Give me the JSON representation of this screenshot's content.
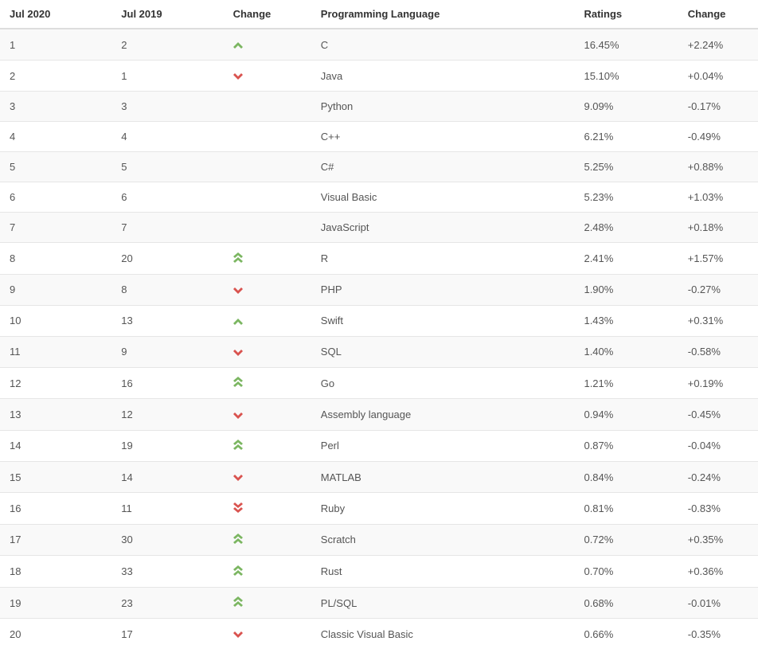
{
  "headers": {
    "jul2020": "Jul 2020",
    "jul2019": "Jul 2019",
    "change": "Change",
    "language": "Programming Language",
    "ratings": "Ratings",
    "delta": "Change"
  },
  "icons": {
    "up": "chevron-up-icon",
    "down": "chevron-down-icon",
    "uu": "double-chevron-up-icon",
    "dd": "double-chevron-down-icon",
    "none": ""
  },
  "rows": [
    {
      "jul2020": "1",
      "jul2019": "2",
      "trend": "up",
      "language": "C",
      "ratings": "16.45%",
      "delta": "+2.24%"
    },
    {
      "jul2020": "2",
      "jul2019": "1",
      "trend": "down",
      "language": "Java",
      "ratings": "15.10%",
      "delta": "+0.04%"
    },
    {
      "jul2020": "3",
      "jul2019": "3",
      "trend": "none",
      "language": "Python",
      "ratings": "9.09%",
      "delta": "-0.17%"
    },
    {
      "jul2020": "4",
      "jul2019": "4",
      "trend": "none",
      "language": "C++",
      "ratings": "6.21%",
      "delta": "-0.49%"
    },
    {
      "jul2020": "5",
      "jul2019": "5",
      "trend": "none",
      "language": "C#",
      "ratings": "5.25%",
      "delta": "+0.88%"
    },
    {
      "jul2020": "6",
      "jul2019": "6",
      "trend": "none",
      "language": "Visual Basic",
      "ratings": "5.23%",
      "delta": "+1.03%"
    },
    {
      "jul2020": "7",
      "jul2019": "7",
      "trend": "none",
      "language": "JavaScript",
      "ratings": "2.48%",
      "delta": "+0.18%"
    },
    {
      "jul2020": "8",
      "jul2019": "20",
      "trend": "uu",
      "language": "R",
      "ratings": "2.41%",
      "delta": "+1.57%"
    },
    {
      "jul2020": "9",
      "jul2019": "8",
      "trend": "down",
      "language": "PHP",
      "ratings": "1.90%",
      "delta": "-0.27%"
    },
    {
      "jul2020": "10",
      "jul2019": "13",
      "trend": "up",
      "language": "Swift",
      "ratings": "1.43%",
      "delta": "+0.31%"
    },
    {
      "jul2020": "11",
      "jul2019": "9",
      "trend": "down",
      "language": "SQL",
      "ratings": "1.40%",
      "delta": "-0.58%"
    },
    {
      "jul2020": "12",
      "jul2019": "16",
      "trend": "uu",
      "language": "Go",
      "ratings": "1.21%",
      "delta": "+0.19%"
    },
    {
      "jul2020": "13",
      "jul2019": "12",
      "trend": "down",
      "language": "Assembly language",
      "ratings": "0.94%",
      "delta": "-0.45%"
    },
    {
      "jul2020": "14",
      "jul2019": "19",
      "trend": "uu",
      "language": "Perl",
      "ratings": "0.87%",
      "delta": "-0.04%"
    },
    {
      "jul2020": "15",
      "jul2019": "14",
      "trend": "down",
      "language": "MATLAB",
      "ratings": "0.84%",
      "delta": "-0.24%"
    },
    {
      "jul2020": "16",
      "jul2019": "11",
      "trend": "dd",
      "language": "Ruby",
      "ratings": "0.81%",
      "delta": "-0.83%"
    },
    {
      "jul2020": "17",
      "jul2019": "30",
      "trend": "uu",
      "language": "Scratch",
      "ratings": "0.72%",
      "delta": "+0.35%"
    },
    {
      "jul2020": "18",
      "jul2019": "33",
      "trend": "uu",
      "language": "Rust",
      "ratings": "0.70%",
      "delta": "+0.36%"
    },
    {
      "jul2020": "19",
      "jul2019": "23",
      "trend": "uu",
      "language": "PL/SQL",
      "ratings": "0.68%",
      "delta": "-0.01%"
    },
    {
      "jul2020": "20",
      "jul2019": "17",
      "trend": "down",
      "language": "Classic Visual Basic",
      "ratings": "0.66%",
      "delta": "-0.35%"
    }
  ]
}
